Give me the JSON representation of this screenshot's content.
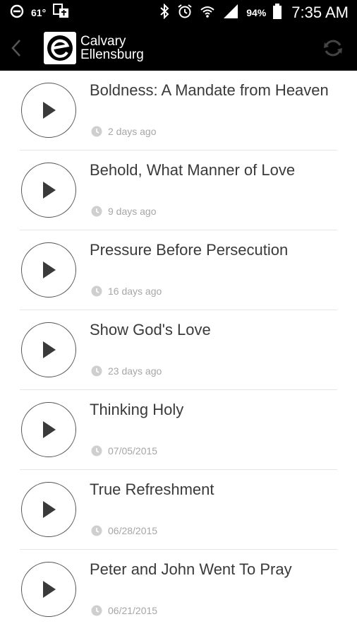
{
  "status_bar": {
    "temperature": "61°",
    "battery": "94%",
    "time": "7:35 AM"
  },
  "app_bar": {
    "brand_line1": "Calvary",
    "brand_line2": "Ellensburg"
  },
  "sermons": [
    {
      "title": "Boldness: A Mandate from Heaven",
      "date": "2 days ago"
    },
    {
      "title": "Behold, What Manner of Love",
      "date": "9 days ago"
    },
    {
      "title": "Pressure Before Persecution",
      "date": "16 days ago"
    },
    {
      "title": "Show God's Love",
      "date": "23 days ago"
    },
    {
      "title": "Thinking Holy",
      "date": "07/05/2015"
    },
    {
      "title": "True Refreshment",
      "date": "06/28/2015"
    },
    {
      "title": "Peter and John Went To Pray",
      "date": "06/21/2015"
    }
  ]
}
